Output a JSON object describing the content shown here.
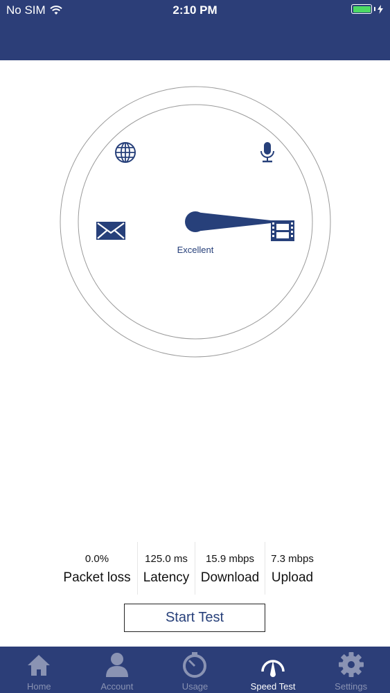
{
  "status_bar": {
    "carrier": "No SIM",
    "time": "2:10 PM",
    "battery_color": "#4cd964"
  },
  "colors": {
    "header": "#2c3e78",
    "accent": "#27407a"
  },
  "gauge": {
    "quality_label": "Excellent",
    "icons": [
      "globe-icon",
      "microphone-icon",
      "envelope-icon",
      "film-icon"
    ],
    "needle_points_to": "film-icon"
  },
  "stats": [
    {
      "value": "0.0%",
      "label": "Packet loss"
    },
    {
      "value": "125.0 ms",
      "label": "Latency"
    },
    {
      "value": "15.9 mbps",
      "label": "Download"
    },
    {
      "value": "7.3 mbps",
      "label": "Upload"
    }
  ],
  "start_button": {
    "label": "Start Test"
  },
  "tabs": [
    {
      "label": "Home",
      "icon": "home-icon",
      "active": false
    },
    {
      "label": "Account",
      "icon": "person-icon",
      "active": false
    },
    {
      "label": "Usage",
      "icon": "timer-icon",
      "active": false
    },
    {
      "label": "Speed Test",
      "icon": "speedometer-icon",
      "active": true
    },
    {
      "label": "Settings",
      "icon": "gear-icon",
      "active": false
    }
  ]
}
